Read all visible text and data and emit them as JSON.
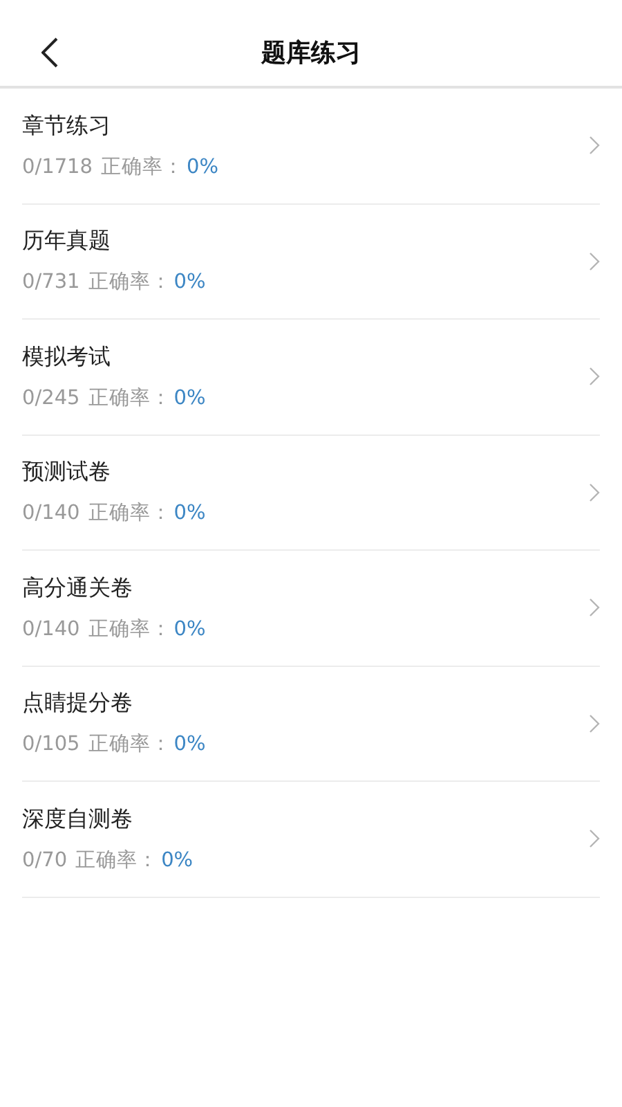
{
  "header": {
    "title": "题库练习"
  },
  "items": [
    {
      "title": "章节练习",
      "progress": "0/1718",
      "accuracy_label": "正确率：",
      "accuracy": "0%"
    },
    {
      "title": "历年真题",
      "progress": "0/731",
      "accuracy_label": "正确率：",
      "accuracy": "0%"
    },
    {
      "title": "模拟考试",
      "progress": "0/245",
      "accuracy_label": "正确率：",
      "accuracy": "0%"
    },
    {
      "title": "预测试卷",
      "progress": "0/140",
      "accuracy_label": "正确率：",
      "accuracy": "0%"
    },
    {
      "title": "高分通关卷",
      "progress": "0/140",
      "accuracy_label": "正确率：",
      "accuracy": "0%"
    },
    {
      "title": "点睛提分卷",
      "progress": "0/105",
      "accuracy_label": "正确率：",
      "accuracy": "0%"
    },
    {
      "title": "深度自测卷",
      "progress": "0/70",
      "accuracy_label": "正确率：",
      "accuracy": "0%"
    }
  ]
}
